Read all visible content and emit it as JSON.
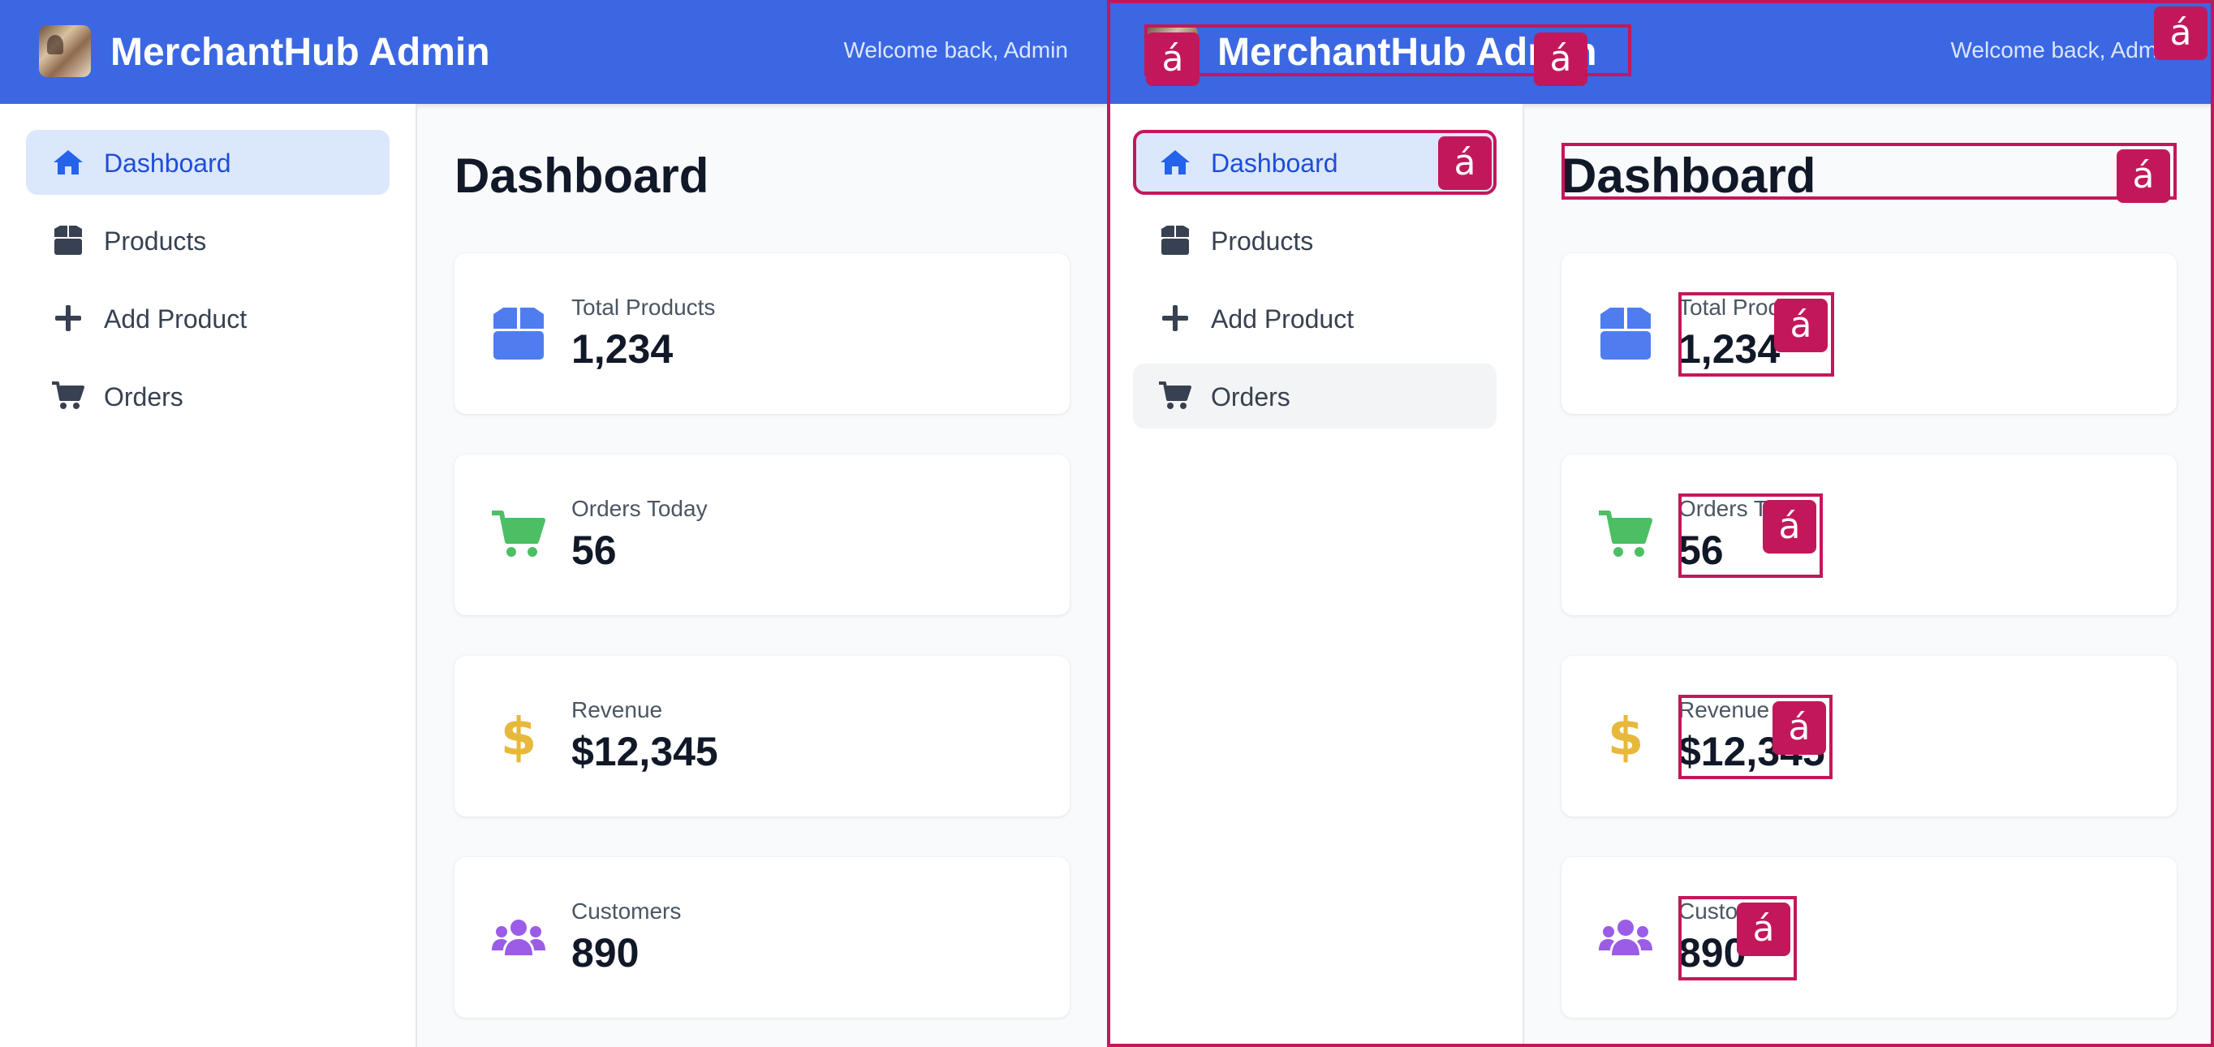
{
  "app": {
    "title": "MerchantHub Admin",
    "welcome": "Welcome back, Admin"
  },
  "sidebar": {
    "items": [
      {
        "label": "Dashboard",
        "icon": "home-icon"
      },
      {
        "label": "Products",
        "icon": "box-icon"
      },
      {
        "label": "Add Product",
        "icon": "plus-icon"
      },
      {
        "label": "Orders",
        "icon": "cart-icon"
      }
    ]
  },
  "main": {
    "title": "Dashboard",
    "stats": [
      {
        "label": "Total Products",
        "value": "1,234",
        "icon": "box-icon",
        "color": "#4f7df0"
      },
      {
        "label": "Orders Today",
        "value": "56",
        "icon": "cart-icon",
        "color": "#4cbf64"
      },
      {
        "label": "Revenue",
        "value": "$12,345",
        "icon": "dollar-icon",
        "color": "#e8b83a"
      },
      {
        "label": "Customers",
        "value": "890",
        "icon": "users-icon",
        "color": "#9b5de5"
      }
    ]
  },
  "overlay": {
    "marker": "á",
    "color": "#c2185b"
  },
  "colors": {
    "header": "#3b67e2",
    "active_bg": "#dbe7fb",
    "active_text": "#1d4ed8"
  }
}
